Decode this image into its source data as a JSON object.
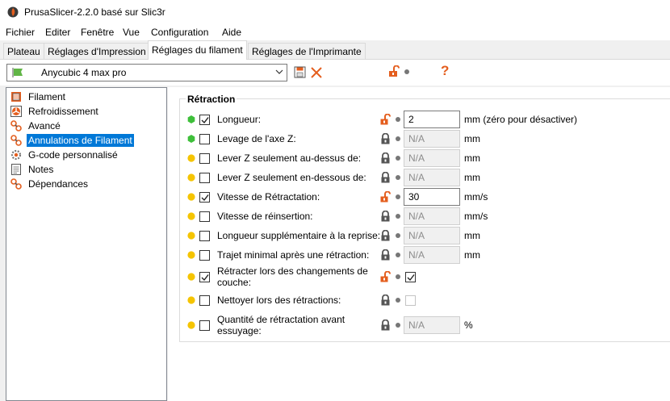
{
  "window": {
    "title": "PrusaSlicer-2.2.0 basé sur Slic3r"
  },
  "menu": [
    "Fichier",
    "Editer",
    "Fenêtre",
    "Vue",
    "Configuration",
    "Aide"
  ],
  "tabs": [
    {
      "label": "Plateau",
      "active": false
    },
    {
      "label": "Réglages d'Impression",
      "active": false
    },
    {
      "label": "Réglages du filament",
      "active": true
    },
    {
      "label": "Réglages de l'Imprimante",
      "active": false
    }
  ],
  "toolbar": {
    "preset": "Anycubic 4 max pro",
    "help_glyph": "?"
  },
  "colors": {
    "accent_orange": "#e45e1e",
    "selection_blue": "#0078d7",
    "dot_green": "#3ebf3a",
    "dot_yellow": "#f5c400",
    "preset_flag": "#61b546"
  },
  "sidebar": {
    "items": [
      {
        "label": "Filament",
        "icon": "spool-icon",
        "selected": false
      },
      {
        "label": "Refroidissement",
        "icon": "fan-icon",
        "selected": false
      },
      {
        "label": "Avancé",
        "icon": "wrench-icon",
        "selected": false
      },
      {
        "label": "Annulations de Filament",
        "icon": "wrench-icon",
        "selected": true
      },
      {
        "label": "G-code personnalisé",
        "icon": "cog-icon",
        "selected": false
      },
      {
        "label": "Notes",
        "icon": "notes-icon",
        "selected": false
      },
      {
        "label": "Dépendances",
        "icon": "wrench-icon",
        "selected": false
      }
    ]
  },
  "section": {
    "title": "Rétraction",
    "rows": [
      {
        "dot": "green",
        "checked": true,
        "label": [
          "Longueur:"
        ],
        "lock": "open",
        "value": "2",
        "value_enabled": true,
        "unit": "mm (zéro pour désactiver)"
      },
      {
        "dot": "green",
        "checked": false,
        "label": [
          "Levage de l'axe Z:"
        ],
        "lock": "closed",
        "value": "N/A",
        "value_enabled": false,
        "unit": "mm"
      },
      {
        "dot": "yellow",
        "checked": false,
        "label": [
          "Lever Z seulement au-dessus de:"
        ],
        "lock": "closed",
        "value": "N/A",
        "value_enabled": false,
        "unit": "mm"
      },
      {
        "dot": "yellow",
        "checked": false,
        "label": [
          "Lever Z seulement en-dessous de:"
        ],
        "lock": "closed",
        "value": "N/A",
        "value_enabled": false,
        "unit": "mm"
      },
      {
        "dot": "yellow",
        "checked": true,
        "label": [
          "Vitesse de Rétractation:"
        ],
        "lock": "open",
        "value": "30",
        "value_enabled": true,
        "unit": "mm/s"
      },
      {
        "dot": "yellow",
        "checked": false,
        "label": [
          "Vitesse de réinsertion:"
        ],
        "lock": "closed",
        "value": "N/A",
        "value_enabled": false,
        "unit": "mm/s"
      },
      {
        "dot": "yellow",
        "checked": false,
        "label": [
          "Longueur supplémentaire à la reprise:"
        ],
        "lock": "closed",
        "value": "N/A",
        "value_enabled": false,
        "unit": "mm"
      },
      {
        "dot": "yellow",
        "checked": false,
        "label": [
          "Trajet minimal après une rétraction:"
        ],
        "lock": "closed",
        "value": "N/A",
        "value_enabled": false,
        "unit": "mm"
      },
      {
        "dot": "yellow",
        "checked": true,
        "label": [
          "Rétracter lors des changements de",
          "couche:"
        ],
        "lock": "open",
        "checkbox_value": true,
        "checkbox_enabled": true
      },
      {
        "dot": "yellow",
        "checked": false,
        "label": [
          "Nettoyer lors des rétractions:"
        ],
        "lock": "closed",
        "checkbox_value": false,
        "checkbox_enabled": false
      },
      {
        "dot": "yellow",
        "checked": false,
        "label": [
          "Quantité de rétractation avant",
          "essuyage:"
        ],
        "lock": "closed",
        "value": "N/A",
        "value_enabled": false,
        "unit": "%"
      }
    ]
  }
}
